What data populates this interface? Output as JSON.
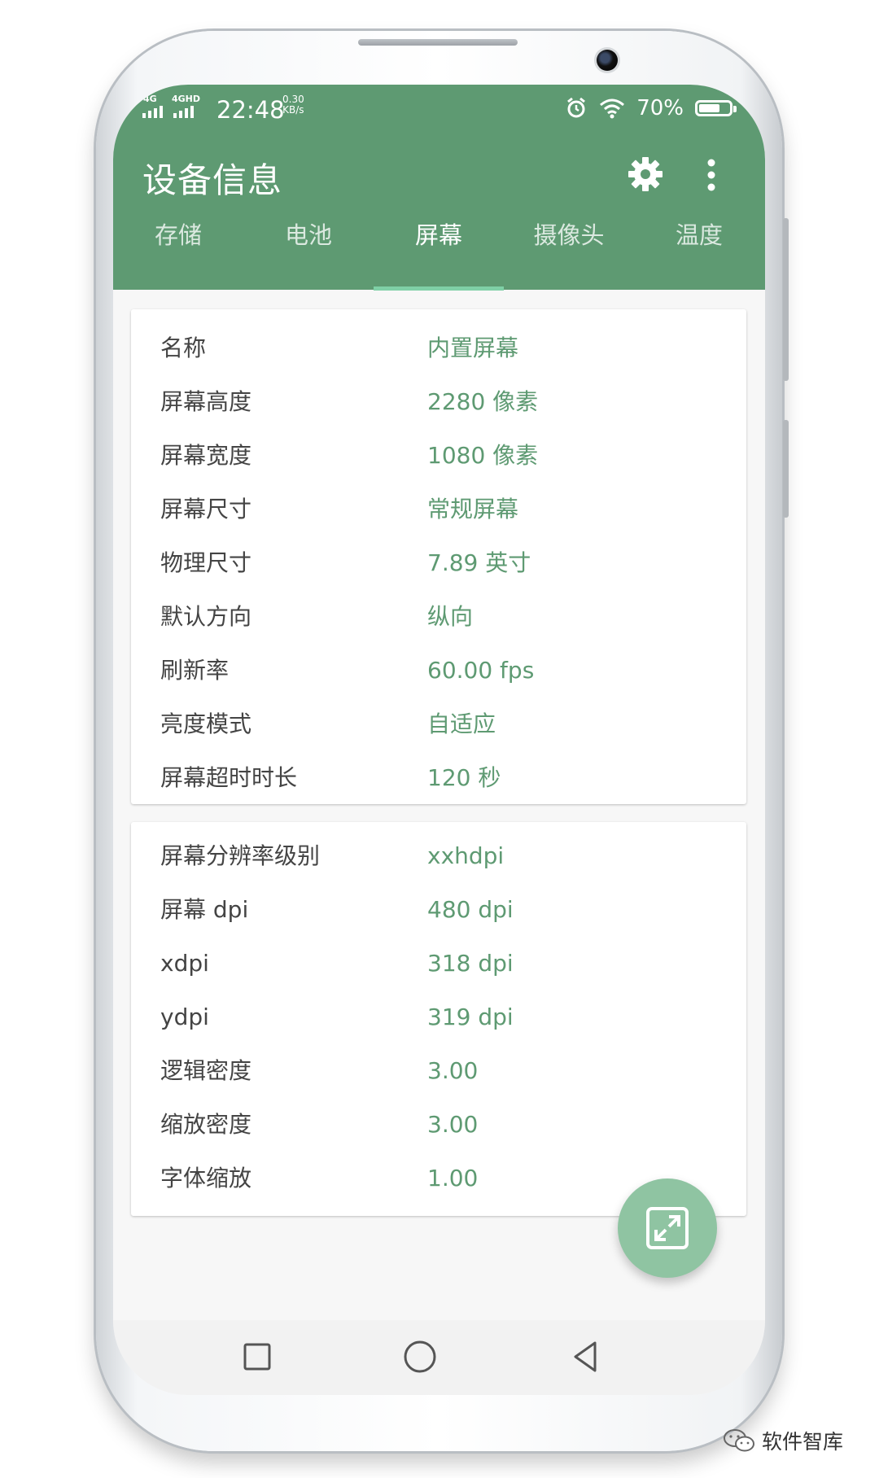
{
  "status_bar": {
    "sim1": "4G",
    "sim2": "4GHD",
    "time": "22:48",
    "speed_value": "0.30",
    "speed_unit": "KB/s",
    "battery_text": "70%",
    "battery_level": 0.7,
    "icons": [
      "alarm-icon",
      "wifi-icon",
      "battery-icon"
    ]
  },
  "appbar": {
    "title": "设备信息",
    "actions": [
      "settings-gear-icon",
      "more-vertical-icon"
    ]
  },
  "tabs": [
    {
      "label": "存储"
    },
    {
      "label": "电池"
    },
    {
      "label": "屏幕",
      "active": true
    },
    {
      "label": "摄像头"
    },
    {
      "label": "温度"
    }
  ],
  "card1": {
    "rows": [
      {
        "key": "名称",
        "value": "内置屏幕"
      },
      {
        "key": "屏幕高度",
        "value": "2280 像素"
      },
      {
        "key": "屏幕宽度",
        "value": "1080 像素"
      },
      {
        "key": "屏幕尺寸",
        "value": "常规屏幕"
      },
      {
        "key": "物理尺寸",
        "value": "7.89  英寸"
      },
      {
        "key": "默认方向",
        "value": "纵向"
      },
      {
        "key": "刷新率",
        "value": "60.00 fps"
      },
      {
        "key": "亮度模式",
        "value": "自适应"
      },
      {
        "key": "屏幕超时时长",
        "value": "120 秒"
      }
    ]
  },
  "card2": {
    "rows": [
      {
        "key": "屏幕分辨率级别",
        "value": "xxhdpi"
      },
      {
        "key": "屏幕 dpi",
        "value": "480 dpi"
      },
      {
        "key": "xdpi",
        "value": "318 dpi"
      },
      {
        "key": "ydpi",
        "value": "319 dpi"
      },
      {
        "key": "逻辑密度",
        "value": "3.00"
      },
      {
        "key": "缩放密度",
        "value": "3.00"
      },
      {
        "key": "字体缩放",
        "value": "1.00"
      }
    ]
  },
  "fab": {
    "icon": "expand-icon"
  },
  "navbar": {
    "icons": [
      "recents-square-icon",
      "home-circle-icon",
      "back-triangle-icon"
    ]
  },
  "watermark": {
    "text": "软件智库"
  },
  "colors": {
    "primary": "#5e9a72",
    "indicator": "#7fd0a6",
    "fab": "#8fc4a2"
  }
}
